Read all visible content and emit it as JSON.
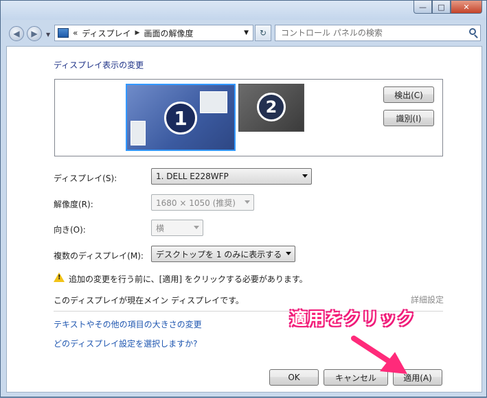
{
  "window": {
    "caption_buttons": {
      "minimize": "—",
      "maximize": "□",
      "close": "✕"
    }
  },
  "nav": {
    "back_icon": "back-arrow-icon",
    "forward_icon": "forward-arrow-icon",
    "breadcrumb_prefix": "«",
    "breadcrumb": [
      "ディスプレイ",
      "画面の解像度"
    ],
    "search_placeholder": "コントロール パネルの検索"
  },
  "section": {
    "title": "ディスプレイ表示の変更"
  },
  "preview": {
    "monitors": [
      {
        "number": "1",
        "selected": true
      },
      {
        "number": "2",
        "selected": false
      }
    ],
    "detect_label": "検出(C)",
    "identify_label": "識別(I)"
  },
  "settings": {
    "display_label": "ディスプレイ(S):",
    "display_value": "1. DELL E228WFP",
    "resolution_label": "解像度(R):",
    "resolution_value": "1680 × 1050 (推奨)",
    "orientation_label": "向き(O):",
    "orientation_value": "横",
    "multi_label": "複数のディスプレイ(M):",
    "multi_value": "デスクトップを 1 のみに表示する"
  },
  "warning": {
    "text": "追加の変更を行う前に、[適用] をクリックする必要があります。"
  },
  "main_display_text": "このディスプレイが現在メイン ディスプレイです。",
  "advanced_label": "詳細設定",
  "links": [
    "テキストやその他の項目の大きさの変更",
    "どのディスプレイ設定を選択しますか?"
  ],
  "footer": {
    "ok": "OK",
    "cancel": "キャンセル",
    "apply": "適用(A)"
  },
  "annotation": {
    "text": "適用をクリック",
    "color": "#ff2a7a"
  }
}
